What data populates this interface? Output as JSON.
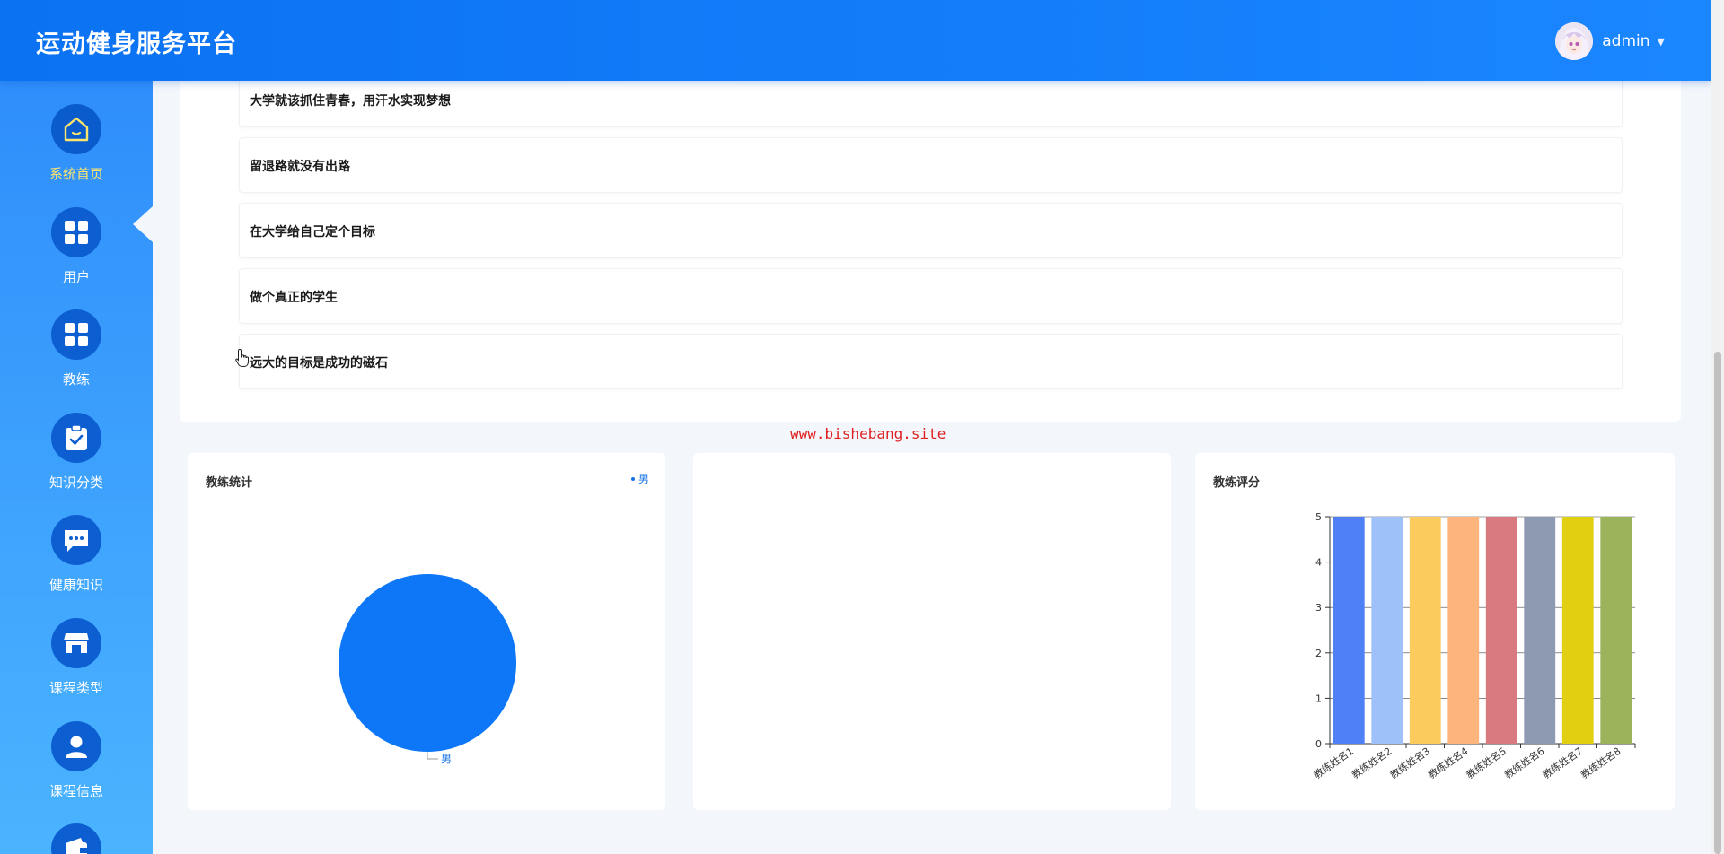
{
  "header": {
    "brand": "运动健身服务平台",
    "username": "admin",
    "caret": "▼"
  },
  "sidebar": {
    "items": [
      {
        "label": "系统首页",
        "icon": "home-icon",
        "active": true
      },
      {
        "label": "用户",
        "icon": "grid-icon"
      },
      {
        "label": "教练",
        "icon": "grid-icon"
      },
      {
        "label": "知识分类",
        "icon": "clipboard-check-icon"
      },
      {
        "label": "健康知识",
        "icon": "chat-bubble-icon"
      },
      {
        "label": "课程类型",
        "icon": "store-icon"
      },
      {
        "label": "课程信息",
        "icon": "user-icon"
      },
      {
        "label": "",
        "icon": "wallet-icon"
      }
    ]
  },
  "notices": [
    {
      "text": "大学就该抓住青春，用汗水实现梦想"
    },
    {
      "text": "留退路就没有出路"
    },
    {
      "text": "在大学给自己定个目标"
    },
    {
      "text": "做个真正的学生"
    },
    {
      "text": "远大的目标是成功的磁石"
    }
  ],
  "watermark": "www.bishebang.site",
  "colors": {
    "accent": "#0b72f2",
    "pie": "#0d77f7",
    "active_label": "#ffe56b"
  },
  "charts": {
    "coach_stats": {
      "title": "教练统计",
      "legend": "男"
    },
    "coach_rating": {
      "title": "教练评分"
    }
  },
  "chart_data": [
    {
      "type": "pie",
      "title": "教练统计",
      "labels": [
        "男"
      ],
      "values": [
        1
      ],
      "legend": "top-right",
      "colors": [
        "#0d77f7"
      ]
    },
    {
      "type": "bar",
      "title": "教练评分",
      "categories": [
        "教练姓名1",
        "教练姓名2",
        "教练姓名3",
        "教练姓名4",
        "教练姓名5",
        "教练姓名6",
        "教练姓名7",
        "教练姓名8"
      ],
      "values": [
        5,
        5,
        5,
        5,
        5,
        5,
        5,
        5
      ],
      "ylim": [
        0,
        5
      ],
      "yticks": [
        0,
        1,
        2,
        3,
        4,
        5
      ],
      "grid": true,
      "colors": [
        "#5080f5",
        "#9fc1fa",
        "#fccb5e",
        "#fdb47d",
        "#d97a80",
        "#8e9ab2",
        "#e3cf12",
        "#9bb35a"
      ]
    }
  ]
}
